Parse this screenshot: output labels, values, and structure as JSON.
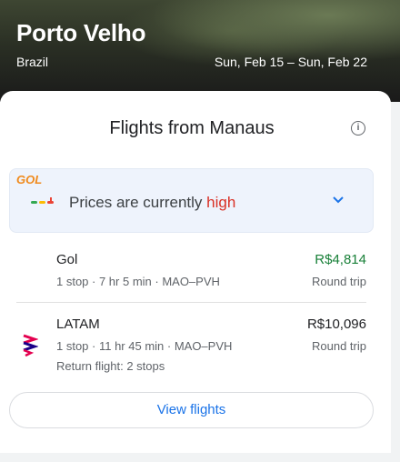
{
  "hero": {
    "title": "Porto Velho",
    "country": "Brazil",
    "dates": "Sun, Feb 15 – Sun, Feb 22"
  },
  "card": {
    "title": "Flights from Manaus",
    "info_icon": "info-icon"
  },
  "price_banner": {
    "prefix": "Prices are currently ",
    "level": "high",
    "level_color": "#d93025"
  },
  "flights": [
    {
      "airline": "Gol",
      "logo_text": "GOL",
      "details": "1 stop · 7 hr 5 min · MAO–PVH",
      "price": "R$4,814",
      "price_color": "#188038",
      "trip": "Round trip"
    },
    {
      "airline": "LATAM",
      "details": "1 stop · 11 hr 45 min · MAO–PVH",
      "extra": "Return flight: 2 stops",
      "price": "R$10,096",
      "price_color": "#202124",
      "trip": "Round trip"
    }
  ],
  "button": {
    "label": "View flights"
  }
}
